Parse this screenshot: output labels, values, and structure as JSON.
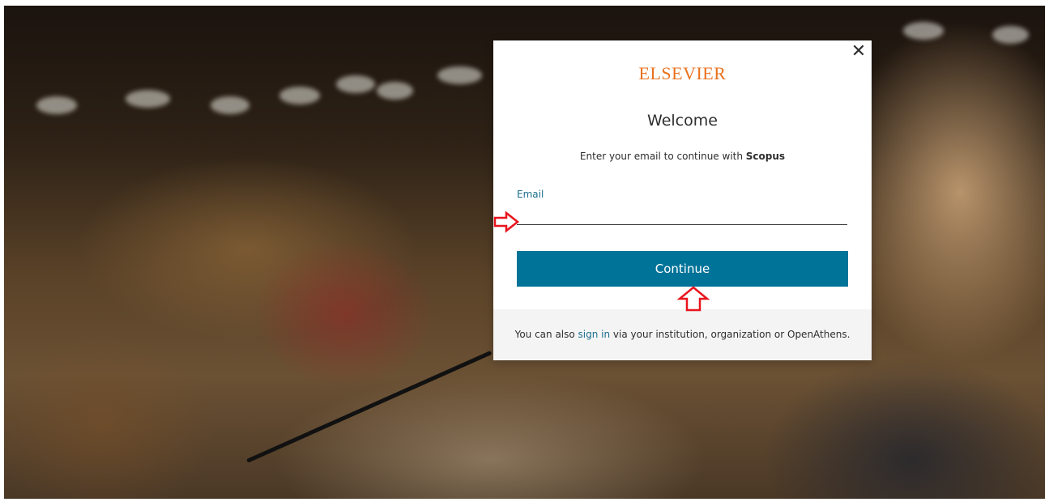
{
  "modal": {
    "logo": "ELSEVIER",
    "close_glyph": "✕",
    "title": "Welcome",
    "subtitle_prefix": "Enter your email to continue with ",
    "subtitle_product": "Scopus",
    "email": {
      "label": "Email",
      "value": "",
      "placeholder": ""
    },
    "continue_label": "Continue",
    "footer": {
      "prefix": "You can also ",
      "link": "sign in",
      "suffix": " via your institution, organization or OpenAthens."
    }
  },
  "colors": {
    "brand_orange": "#e9711c",
    "primary_button": "#007398",
    "link": "#1a6e8e",
    "annotation_red": "#e8141c"
  },
  "icons": {
    "close": "close-icon",
    "right_arrow": "arrow-right-annotation-icon",
    "up_arrow": "arrow-up-annotation-icon"
  }
}
